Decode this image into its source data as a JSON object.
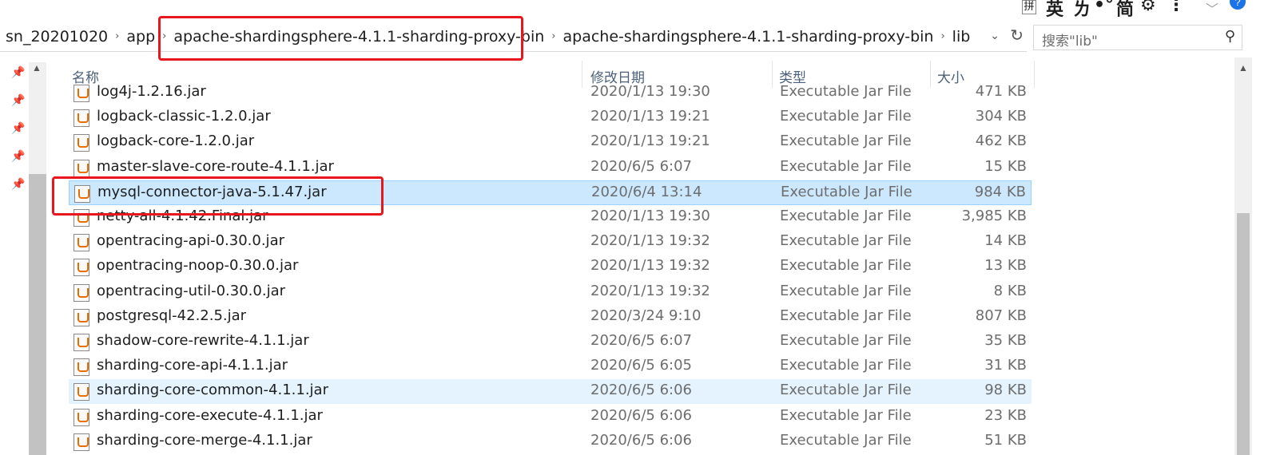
{
  "ime": {
    "box_glyph": "拼",
    "glyphs": [
      "英",
      "ㄌ",
      "•°",
      "简",
      "⚙",
      "⋮"
    ],
    "help": "?"
  },
  "address": {
    "crumbs": [
      "sn_20201020",
      "app",
      "apache-shardingsphere-4.1.1-sharding-proxy-bin",
      "apache-shardingsphere-4.1.1-sharding-proxy-bin",
      "lib"
    ]
  },
  "search": {
    "placeholder": "搜索\"lib\""
  },
  "columns": {
    "name": "名称",
    "date": "修改日期",
    "type": "类型",
    "size": "大小"
  },
  "files": [
    {
      "name": "log4j-1.2.16.jar",
      "date": "2020/1/13 19:30",
      "type": "Executable Jar File",
      "size": "471 KB",
      "state": "normal"
    },
    {
      "name": "logback-classic-1.2.0.jar",
      "date": "2020/1/13 19:21",
      "type": "Executable Jar File",
      "size": "304 KB",
      "state": "normal"
    },
    {
      "name": "logback-core-1.2.0.jar",
      "date": "2020/1/13 19:21",
      "type": "Executable Jar File",
      "size": "462 KB",
      "state": "normal"
    },
    {
      "name": "master-slave-core-route-4.1.1.jar",
      "date": "2020/6/5 6:07",
      "type": "Executable Jar File",
      "size": "15 KB",
      "state": "normal"
    },
    {
      "name": "mysql-connector-java-5.1.47.jar",
      "date": "2020/6/4 13:14",
      "type": "Executable Jar File",
      "size": "984 KB",
      "state": "selected"
    },
    {
      "name": "netty-all-4.1.42.Final.jar",
      "date": "2020/1/13 19:30",
      "type": "Executable Jar File",
      "size": "3,985 KB",
      "state": "normal"
    },
    {
      "name": "opentracing-api-0.30.0.jar",
      "date": "2020/1/13 19:32",
      "type": "Executable Jar File",
      "size": "14 KB",
      "state": "normal"
    },
    {
      "name": "opentracing-noop-0.30.0.jar",
      "date": "2020/1/13 19:32",
      "type": "Executable Jar File",
      "size": "13 KB",
      "state": "normal"
    },
    {
      "name": "opentracing-util-0.30.0.jar",
      "date": "2020/1/13 19:32",
      "type": "Executable Jar File",
      "size": "8 KB",
      "state": "normal"
    },
    {
      "name": "postgresql-42.2.5.jar",
      "date": "2020/3/24 9:10",
      "type": "Executable Jar File",
      "size": "807 KB",
      "state": "normal"
    },
    {
      "name": "shadow-core-rewrite-4.1.1.jar",
      "date": "2020/6/5 6:07",
      "type": "Executable Jar File",
      "size": "35 KB",
      "state": "normal"
    },
    {
      "name": "sharding-core-api-4.1.1.jar",
      "date": "2020/6/5 6:05",
      "type": "Executable Jar File",
      "size": "31 KB",
      "state": "normal"
    },
    {
      "name": "sharding-core-common-4.1.1.jar",
      "date": "2020/6/5 6:06",
      "type": "Executable Jar File",
      "size": "98 KB",
      "state": "hover"
    },
    {
      "name": "sharding-core-execute-4.1.1.jar",
      "date": "2020/6/5 6:06",
      "type": "Executable Jar File",
      "size": "23 KB",
      "state": "normal"
    },
    {
      "name": "sharding-core-merge-4.1.1.jar",
      "date": "2020/6/5 6:06",
      "type": "Executable Jar File",
      "size": "51 KB",
      "state": "normal"
    }
  ],
  "colors": {
    "selected_bg": "#cce8ff",
    "hover_bg": "#e5f3ff",
    "annotation": "#e8171d",
    "header_text": "#4c607a"
  }
}
